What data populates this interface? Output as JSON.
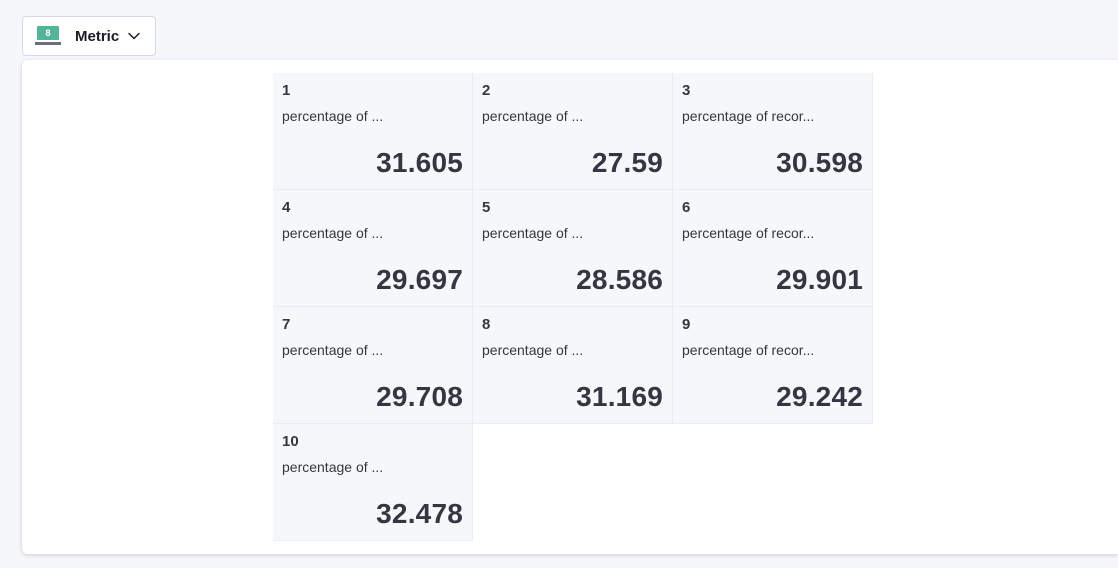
{
  "switcher": {
    "icon_text": "8",
    "label": "Metric",
    "icon": "chevron-down-icon",
    "accent_color": "#54b399"
  },
  "metrics": [
    {
      "title": "1",
      "subtitle": "percentage of ...",
      "value": "31.605"
    },
    {
      "title": "2",
      "subtitle": "percentage of ...",
      "value": "27.59"
    },
    {
      "title": "3",
      "subtitle": "percentage of recor...",
      "value": "30.598"
    },
    {
      "title": "4",
      "subtitle": "percentage of ...",
      "value": "29.697"
    },
    {
      "title": "5",
      "subtitle": "percentage of ...",
      "value": "28.586"
    },
    {
      "title": "6",
      "subtitle": "percentage of recor...",
      "value": "29.901"
    },
    {
      "title": "7",
      "subtitle": "percentage of ...",
      "value": "29.708"
    },
    {
      "title": "8",
      "subtitle": "percentage of ...",
      "value": "31.169"
    },
    {
      "title": "9",
      "subtitle": "percentage of recor...",
      "value": "29.242"
    },
    {
      "title": "10",
      "subtitle": "percentage of ...",
      "value": "32.478"
    }
  ]
}
